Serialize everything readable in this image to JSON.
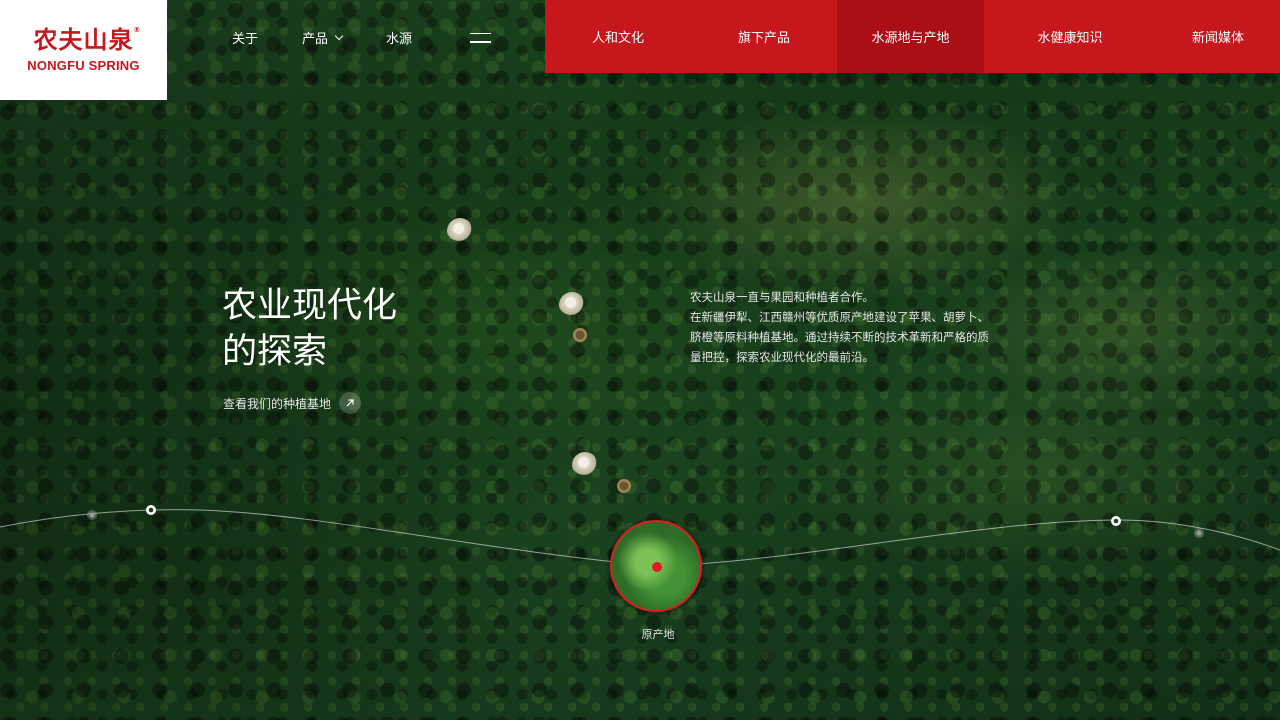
{
  "brand": {
    "name_cn": "农夫山泉",
    "name_en": "NONGFU SPRING",
    "color": "#c8161d"
  },
  "top_nav": {
    "items": [
      {
        "label": "关于"
      },
      {
        "label": "产品"
      },
      {
        "label": "水源"
      }
    ],
    "menu_icon": "hamburger-menu-icon"
  },
  "red_nav": {
    "tabs": [
      {
        "label": "人和文化"
      },
      {
        "label": "旗下产品"
      },
      {
        "label": "水源地与产地",
        "active": true
      },
      {
        "label": "水健康知识"
      },
      {
        "label": "新闻媒体"
      }
    ]
  },
  "hero": {
    "title_line1": "农业现代化",
    "title_line2": "的探索",
    "cta_label": "查看我们的种植基地",
    "cta_icon": "arrow-up-right-icon",
    "description": [
      "农夫山泉一直与果园和种植者合作。",
      "在新疆伊犁、江西赣州等优质原产地建设了苹果、胡萝卜、",
      "脐橙等原料种植基地。通过持续不断的技术革新和严格的质",
      "量把控，探索农业现代化的最前沿。"
    ]
  },
  "timeline": {
    "active_label": "原产地"
  }
}
